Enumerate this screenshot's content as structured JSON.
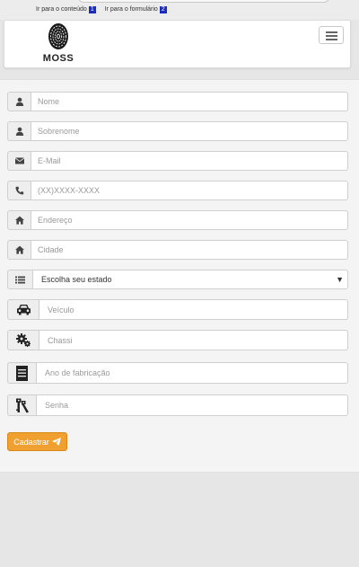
{
  "skiplinks": {
    "content_label": "Ir para o conteúdo",
    "content_key": "1",
    "form_label": "Ir para o formulário",
    "form_key": "2"
  },
  "header": {
    "logo_text": "MOSS"
  },
  "form": {
    "fields": {
      "nome": {
        "placeholder": "Nome",
        "icon": "user-icon"
      },
      "sobrenome": {
        "placeholder": "Sobrenome",
        "icon": "user-icon"
      },
      "email": {
        "placeholder": "E-Mail",
        "icon": "envelope-icon"
      },
      "telefone": {
        "placeholder": "(XX)XXXX-XXXX",
        "icon": "phone-icon"
      },
      "endereco": {
        "placeholder": "Endereço",
        "icon": "home-icon"
      },
      "cidade": {
        "placeholder": "Cidade",
        "icon": "home-icon"
      },
      "estado": {
        "selected": "Escolha seu estado",
        "icon": "list-icon"
      },
      "veiculo": {
        "placeholder": "Veículo",
        "icon": "car-icon"
      },
      "chassi": {
        "placeholder": "Chassi",
        "icon": "gears-icon"
      },
      "ano": {
        "placeholder": "Ano de fabricação",
        "icon": "calendar-icon"
      },
      "senha": {
        "placeholder": "Senha",
        "icon": "keys-icon"
      }
    },
    "submit_label": "Cadastrar",
    "submit_icon": "paper-plane-icon"
  },
  "colors": {
    "accent": "#f0a030",
    "background": "#e6e6e6",
    "panel": "#f4f4f4",
    "skip_key_bg": "#1a2bbd"
  }
}
